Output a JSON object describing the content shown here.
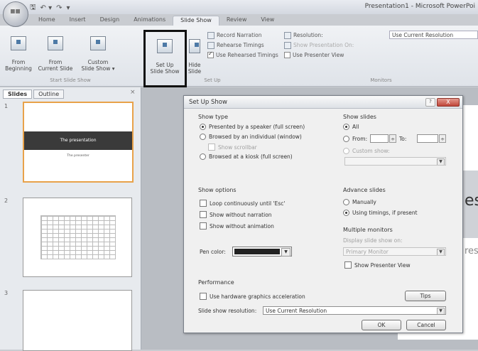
{
  "window": {
    "title": "Presentation1 - Microsoft PowerPoi"
  },
  "qat": {
    "save": "🖫",
    "undo": "↶ ▾",
    "redo": "↷",
    "more": "▾"
  },
  "tabs": [
    "Home",
    "Insert",
    "Design",
    "Animations",
    "Slide Show",
    "Review",
    "View"
  ],
  "active_tab": "Slide Show",
  "ribbon": {
    "start": {
      "from_beginning": "From\nBeginning",
      "from_current": "From\nCurrent Slide",
      "custom": "Custom\nSlide Show ▾",
      "label": "Start Slide Show"
    },
    "setup": {
      "setup_show": "Set Up\nSlide Show",
      "hide_slide": "Hide\nSlide",
      "record_narration": "Record Narration",
      "rehearse": "Rehearse Timings",
      "use_rehearsed": "Use Rehearsed Timings",
      "label": "Set Up"
    },
    "monitors": {
      "resolution": "Resolution:",
      "resolution_value": "Use Current Resolution",
      "show_on": "Show Presentation On:",
      "presenter_view": "Use Presenter View",
      "label": "Monitors"
    }
  },
  "left_pane": {
    "tabs": [
      "Slides",
      "Outline"
    ],
    "close": "×",
    "slides": [
      {
        "num": "1",
        "title": "The presentation",
        "subtitle": "The presenter"
      },
      {
        "num": "2"
      },
      {
        "num": "3"
      }
    ]
  },
  "dialog": {
    "title": "Set Up Show",
    "help": "?",
    "close": "X",
    "show_type": {
      "label": "Show type",
      "presented": "Presented by a speaker (full screen)",
      "browsed_individual": "Browsed by an individual (window)",
      "show_scrollbar": "Show scrollbar",
      "browsed_kiosk": "Browsed at a kiosk (full screen)"
    },
    "show_options": {
      "label": "Show options",
      "loop": "Loop continuously until 'Esc'",
      "no_narration": "Show without narration",
      "no_animation": "Show without animation",
      "pen_color": "Pen color:"
    },
    "performance": {
      "label": "Performance",
      "hw_accel": "Use hardware graphics acceleration",
      "tips": "Tips",
      "resolution_label": "Slide show resolution:",
      "resolution_value": "Use Current Resolution"
    },
    "show_slides": {
      "label": "Show slides",
      "all": "All",
      "from": "From:",
      "to": "To:",
      "custom_show": "Custom show:"
    },
    "advance_slides": {
      "label": "Advance slides",
      "manually": "Manually",
      "timings": "Using timings, if present"
    },
    "multiple_monitors": {
      "label": "Multiple monitors",
      "display_on": "Display slide show on:",
      "monitor_value": "Primary Monitor",
      "presenter_view": "Show Presenter View"
    },
    "ok": "OK",
    "cancel": "Cancel"
  },
  "canvas_text": {
    "right_es": "es",
    "right_res": "res"
  }
}
